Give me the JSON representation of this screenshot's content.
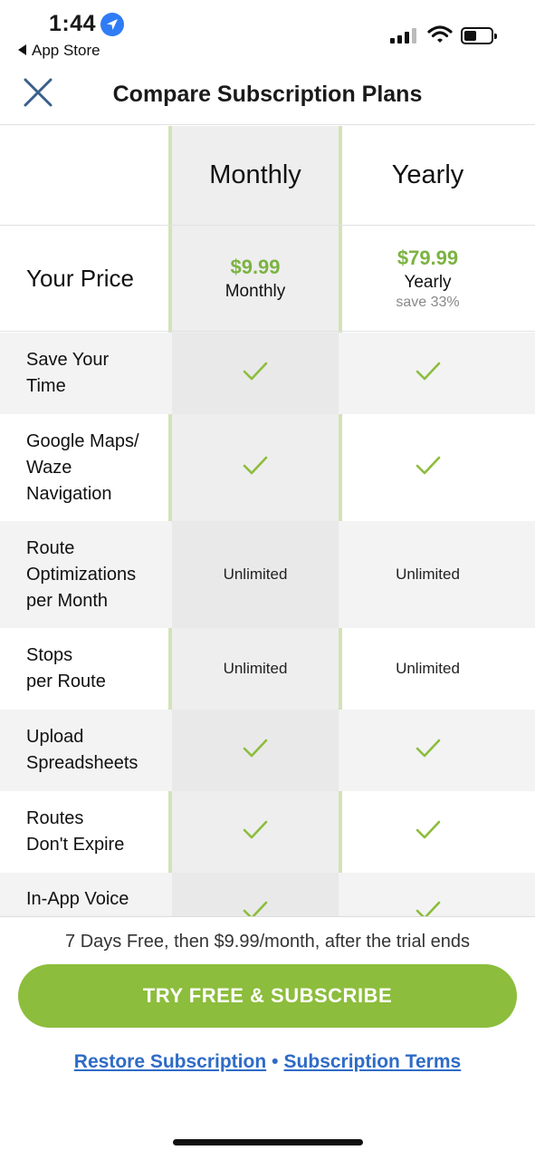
{
  "status_bar": {
    "time": "1:44",
    "back_app": "App Store",
    "location_icon": "location-arrow-icon",
    "signal_icon": "cellular-signal-icon",
    "wifi_icon": "wifi-icon",
    "battery_icon": "battery-icon"
  },
  "header": {
    "title": "Compare Subscription Plans",
    "close_icon": "close-icon"
  },
  "plans": {
    "monthly": "Monthly",
    "yearly": "Yearly"
  },
  "price_row": {
    "label": "Your Price",
    "monthly_price": "$9.99",
    "monthly_period": "Monthly",
    "yearly_price": "$79.99",
    "yearly_period": "Yearly",
    "yearly_save": "save 33%"
  },
  "features": [
    {
      "line1": "Save Your",
      "line2": "Time",
      "line3": "",
      "monthly": "check",
      "yearly": "check"
    },
    {
      "line1": "Google Maps/",
      "line2": "Waze",
      "line3": "Navigation",
      "monthly": "check",
      "yearly": "check"
    },
    {
      "line1": "Route",
      "line2": "Optimizations",
      "line3": "per Month",
      "monthly": "Unlimited",
      "yearly": "Unlimited"
    },
    {
      "line1": "Stops",
      "line2": "per Route",
      "line3": "",
      "monthly": "Unlimited",
      "yearly": "Unlimited"
    },
    {
      "line1": "Upload",
      "line2": "Spreadsheets",
      "line3": "",
      "monthly": "check",
      "yearly": "check"
    },
    {
      "line1": "Routes",
      "line2": "Don't Expire",
      "line3": "",
      "monthly": "check",
      "yearly": "check"
    },
    {
      "line1": "In-App Voice",
      "line2": "",
      "line3": "",
      "monthly": "check",
      "yearly": "check"
    }
  ],
  "footer": {
    "trial_note": "7 Days Free, then $9.99/month, after the trial ends",
    "cta_label": "TRY FREE & SUBSCRIBE",
    "restore_label": "Restore Subscription",
    "separator": "•",
    "terms_label": "Subscription Terms"
  },
  "colors": {
    "accent_green": "#8cbd3c",
    "price_green": "#7cb342",
    "link_blue": "#2e6bc6",
    "monthly_band": "#eeeeee"
  }
}
